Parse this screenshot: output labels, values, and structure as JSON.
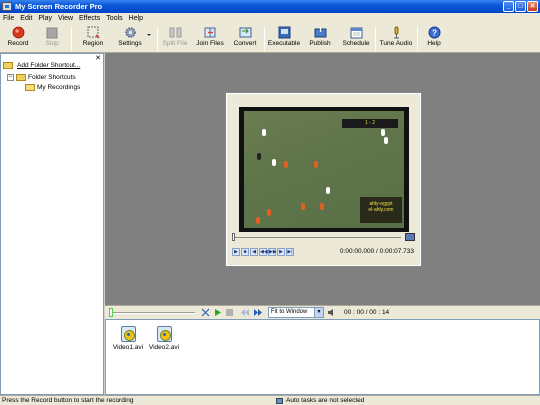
{
  "window": {
    "title": "My Screen Recorder Pro",
    "minimize": "_",
    "maximize": "□",
    "close": "✕"
  },
  "menu": [
    "File",
    "Edit",
    "Play",
    "View",
    "Effects",
    "Tools",
    "Help"
  ],
  "toolbar": {
    "record": "Record",
    "stop": "Stop",
    "region": "Region",
    "settings": "Settings",
    "split_file": "Split File",
    "join_files": "Join Files",
    "convert": "Convert",
    "executable": "Executable",
    "publish": "Publish",
    "schedule": "Schedule",
    "tune_audio": "Tune Audio",
    "help": "Help"
  },
  "left_pane": {
    "close": "✕",
    "add_shortcut": "Add Folder Shortcut...",
    "tree": {
      "root": "Folder Shortcuts",
      "root_toggle": "−",
      "child": "My Recordings"
    }
  },
  "player": {
    "time": "0:00:00.000 / 0:00:07.733",
    "position_fraction": 0.0,
    "overlay_score": "1 - 2",
    "watermark_line1": "ahly-egypt",
    "watermark_line2": "el-ahly.com"
  },
  "bottom_bar": {
    "fit_option": "Fit to Window",
    "counter": "00 : 00 / 00 : 14"
  },
  "files": [
    {
      "name": "Video1.avi"
    },
    {
      "name": "Video2.avi"
    }
  ],
  "status": {
    "left": "Press the Record button to start the recording",
    "right": "Auto tasks are not selected"
  },
  "colors": {
    "record_red": "#d83a1f",
    "title_blue": "#0a58d8",
    "workspace_gray": "#808080"
  }
}
